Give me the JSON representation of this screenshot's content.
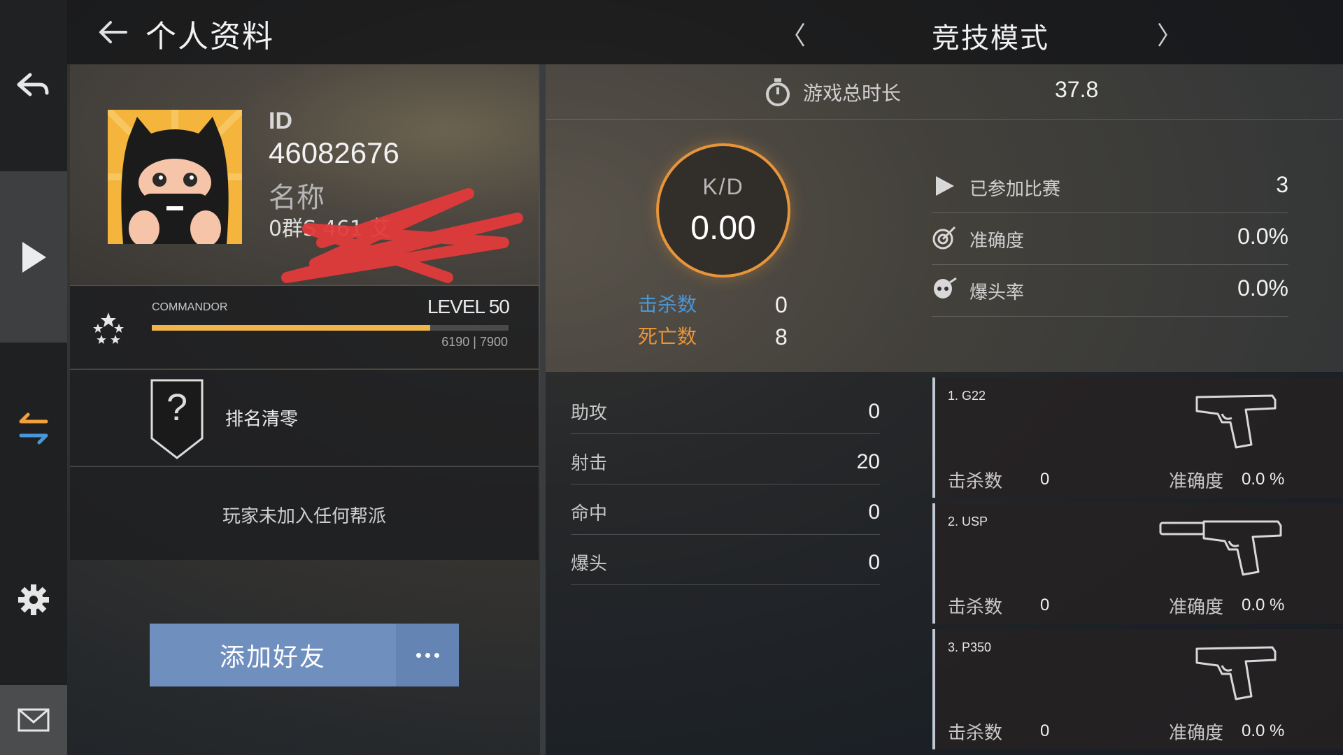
{
  "header": {
    "title": "个人资料",
    "mode_title": "竞技模式",
    "mode_prev": "〈",
    "mode_next": "〉"
  },
  "rail": {
    "icons": [
      "back-arrow-icon",
      "play-icon",
      "swap-arrows-icon",
      "gear-icon",
      "mail-icon"
    ]
  },
  "profile": {
    "id_label": "ID",
    "id_value": "46082676",
    "name_label": "名称",
    "name_value": "0群S        461          艾"
  },
  "level": {
    "rank_name": "COMMANDOR",
    "level_text": "LEVEL 50",
    "xp_text": "6190 | 7900",
    "xp_fraction": 0.78
  },
  "rank": {
    "badge_symbol": "?",
    "reset_label": "排名清零"
  },
  "clan": {
    "text": "玩家未加入任何帮派"
  },
  "actions": {
    "add_friend": "添加好友"
  },
  "summary": {
    "playtime_label": "游戏总时长",
    "playtime_value": "37.8",
    "kd_label": "K/D",
    "kd_value": "0.00",
    "kills_label": "击杀数",
    "kills_value": "0",
    "deaths_label": "死亡数",
    "deaths_value": "8",
    "kills_color": "#4a97d8",
    "deaths_color": "#e8953a"
  },
  "side_stats": [
    {
      "label": "已参加比赛",
      "value": "3",
      "icon": "play-icon"
    },
    {
      "label": "准确度",
      "value": "0.0%",
      "icon": "target-icon"
    },
    {
      "label": "爆头率",
      "value": "0.0%",
      "icon": "skull-icon"
    }
  ],
  "bottom_stats": [
    {
      "label": "助攻",
      "value": "0"
    },
    {
      "label": "射击",
      "value": "20"
    },
    {
      "label": "命中",
      "value": "0"
    },
    {
      "label": "爆头",
      "value": "0"
    }
  ],
  "weapons": [
    {
      "name": "1. G22",
      "kills_label": "击杀数",
      "kills": "0",
      "acc_label": "准确度",
      "acc": "0.0 %",
      "icon": "pistol-icon"
    },
    {
      "name": "2. USP",
      "kills_label": "击杀数",
      "kills": "0",
      "acc_label": "准确度",
      "acc": "0.0 %",
      "icon": "silenced-pistol-icon"
    },
    {
      "name": "3. P350",
      "kills_label": "击杀数",
      "kills": "0",
      "acc_label": "准确度",
      "acc": "0.0 %",
      "icon": "pistol-icon"
    }
  ]
}
